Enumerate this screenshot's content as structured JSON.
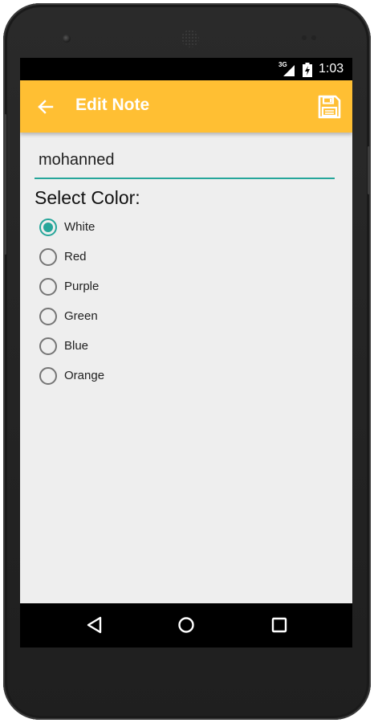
{
  "status_bar": {
    "network": "3G",
    "time": "1:03"
  },
  "app_bar": {
    "title": "Edit Note",
    "back_icon": "arrow-back-icon",
    "save_icon": "save-floppy-icon",
    "color": "#FFBF33"
  },
  "note": {
    "title_value": "mohanned"
  },
  "color_select": {
    "label": "Select Color:",
    "options": [
      "White",
      "Red",
      "Purple",
      "Green",
      "Blue",
      "Orange"
    ],
    "selected": "White"
  },
  "nav_bar": {
    "icons": [
      "nav-back-icon",
      "nav-home-icon",
      "nav-recent-apps-icon"
    ]
  },
  "colors": {
    "accent": "#26A69A",
    "app_bar": "#FFBF33",
    "background": "#EEEEEE"
  }
}
